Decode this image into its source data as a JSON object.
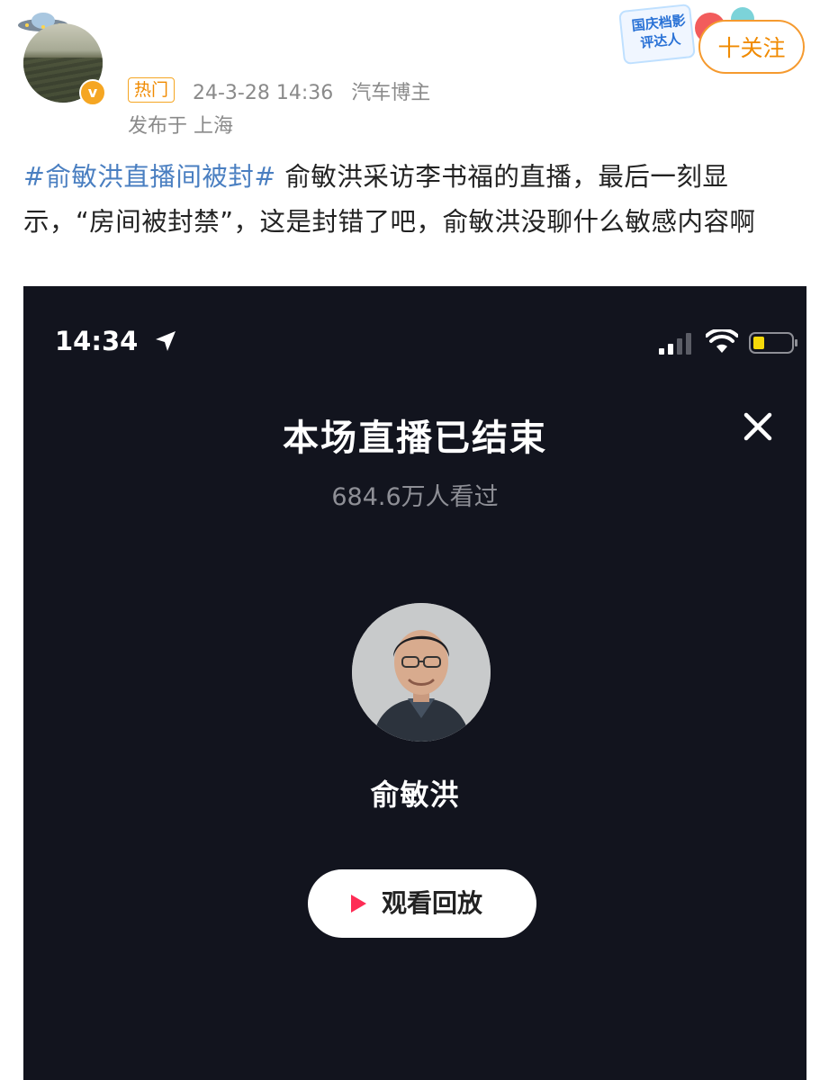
{
  "post": {
    "hot_tag": "热门",
    "date_time": "24-3-28 14:36",
    "author_category": "汽车博主",
    "location": "发布于 上海",
    "follow_label": "十关注",
    "event_badge_text": "国庆档影评达人",
    "verified_mark": "v",
    "hashtag": "#俞敏洪直播间被封#",
    "body_text": " 俞敏洪采访李书福的直播，最后一刻显示，“房间被封禁”，这是封错了吧，俞敏洪没聊什么敏感内容啊"
  },
  "screenshot": {
    "status_bar": {
      "time": "14:34",
      "battery_color": "#f5d90a"
    },
    "title": "本场直播已结束",
    "viewer_count": "684.6万人看过",
    "host_name": "俞敏洪",
    "replay_label": "观看回放",
    "accent_color": "#fe2c55"
  },
  "icons": [
    "ufo-icon",
    "verified-icon",
    "location-arrow-icon",
    "signal-icon",
    "wifi-icon",
    "battery-icon",
    "close-icon",
    "play-icon"
  ]
}
